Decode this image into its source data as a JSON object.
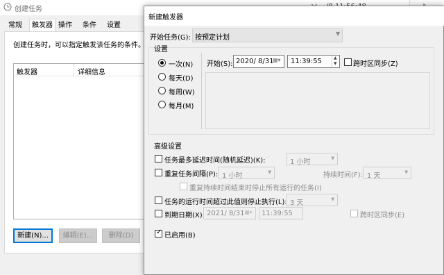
{
  "background_window": {
    "title": "创建任务",
    "close_glyph": "×",
    "time_text": "/8 11:56:48",
    "tabs": [
      "常规",
      "触发器",
      "操作",
      "条件",
      "设置"
    ],
    "active_tab": "触发器",
    "description": "创建任务时，可以指定触发该任务的条件。",
    "list_columns": [
      "触发器",
      "详细信息"
    ],
    "buttons": {
      "new": "新建(N)...",
      "edit": "编辑(E)...",
      "delete": "删除(D)"
    }
  },
  "dialog": {
    "title": "新建触发器",
    "start_task_label": "开始任务(G):",
    "start_task_value": "按预定计划",
    "settings_group_label": "设置",
    "schedule_options": [
      {
        "label": "一次(N)",
        "checked": true
      },
      {
        "label": "每天(D)",
        "checked": false
      },
      {
        "label": "每周(W)",
        "checked": false
      },
      {
        "label": "每月(M)",
        "checked": false
      }
    ],
    "start_label": "开始(S):",
    "start_date": "2020/ 8/31",
    "start_time": "11:39:55",
    "sync_timezone_label": "跨时区同步(Z)",
    "advanced_label": "高级设置",
    "advanced": {
      "delay_label": "任务最多延迟时间(随机延迟)(K):",
      "delay_value": "1 小时",
      "repeat_label": "重复任务间隔(P):",
      "repeat_value": "1 小时",
      "duration_label": "持续时间(F):",
      "duration_value": "1 天",
      "stop_all_label": "重复持续时间结束时停止所有运行的任务(I)",
      "stop_longer_label": "任务的运行时间超过此值则停止执行(L):",
      "stop_longer_value": "3 天",
      "expire_label": "到期日期(X):",
      "expire_date": "2021/ 8/31",
      "expire_time": "11:39:55",
      "expire_sync_label": "跨时区同步(E)",
      "enabled_label": "已启用(B)",
      "enabled_checked": true
    }
  },
  "colors": {
    "dialog_bg": "#f0f0f0",
    "accent_border": "#0078d7",
    "disabled_text": "#8c8c8c"
  }
}
